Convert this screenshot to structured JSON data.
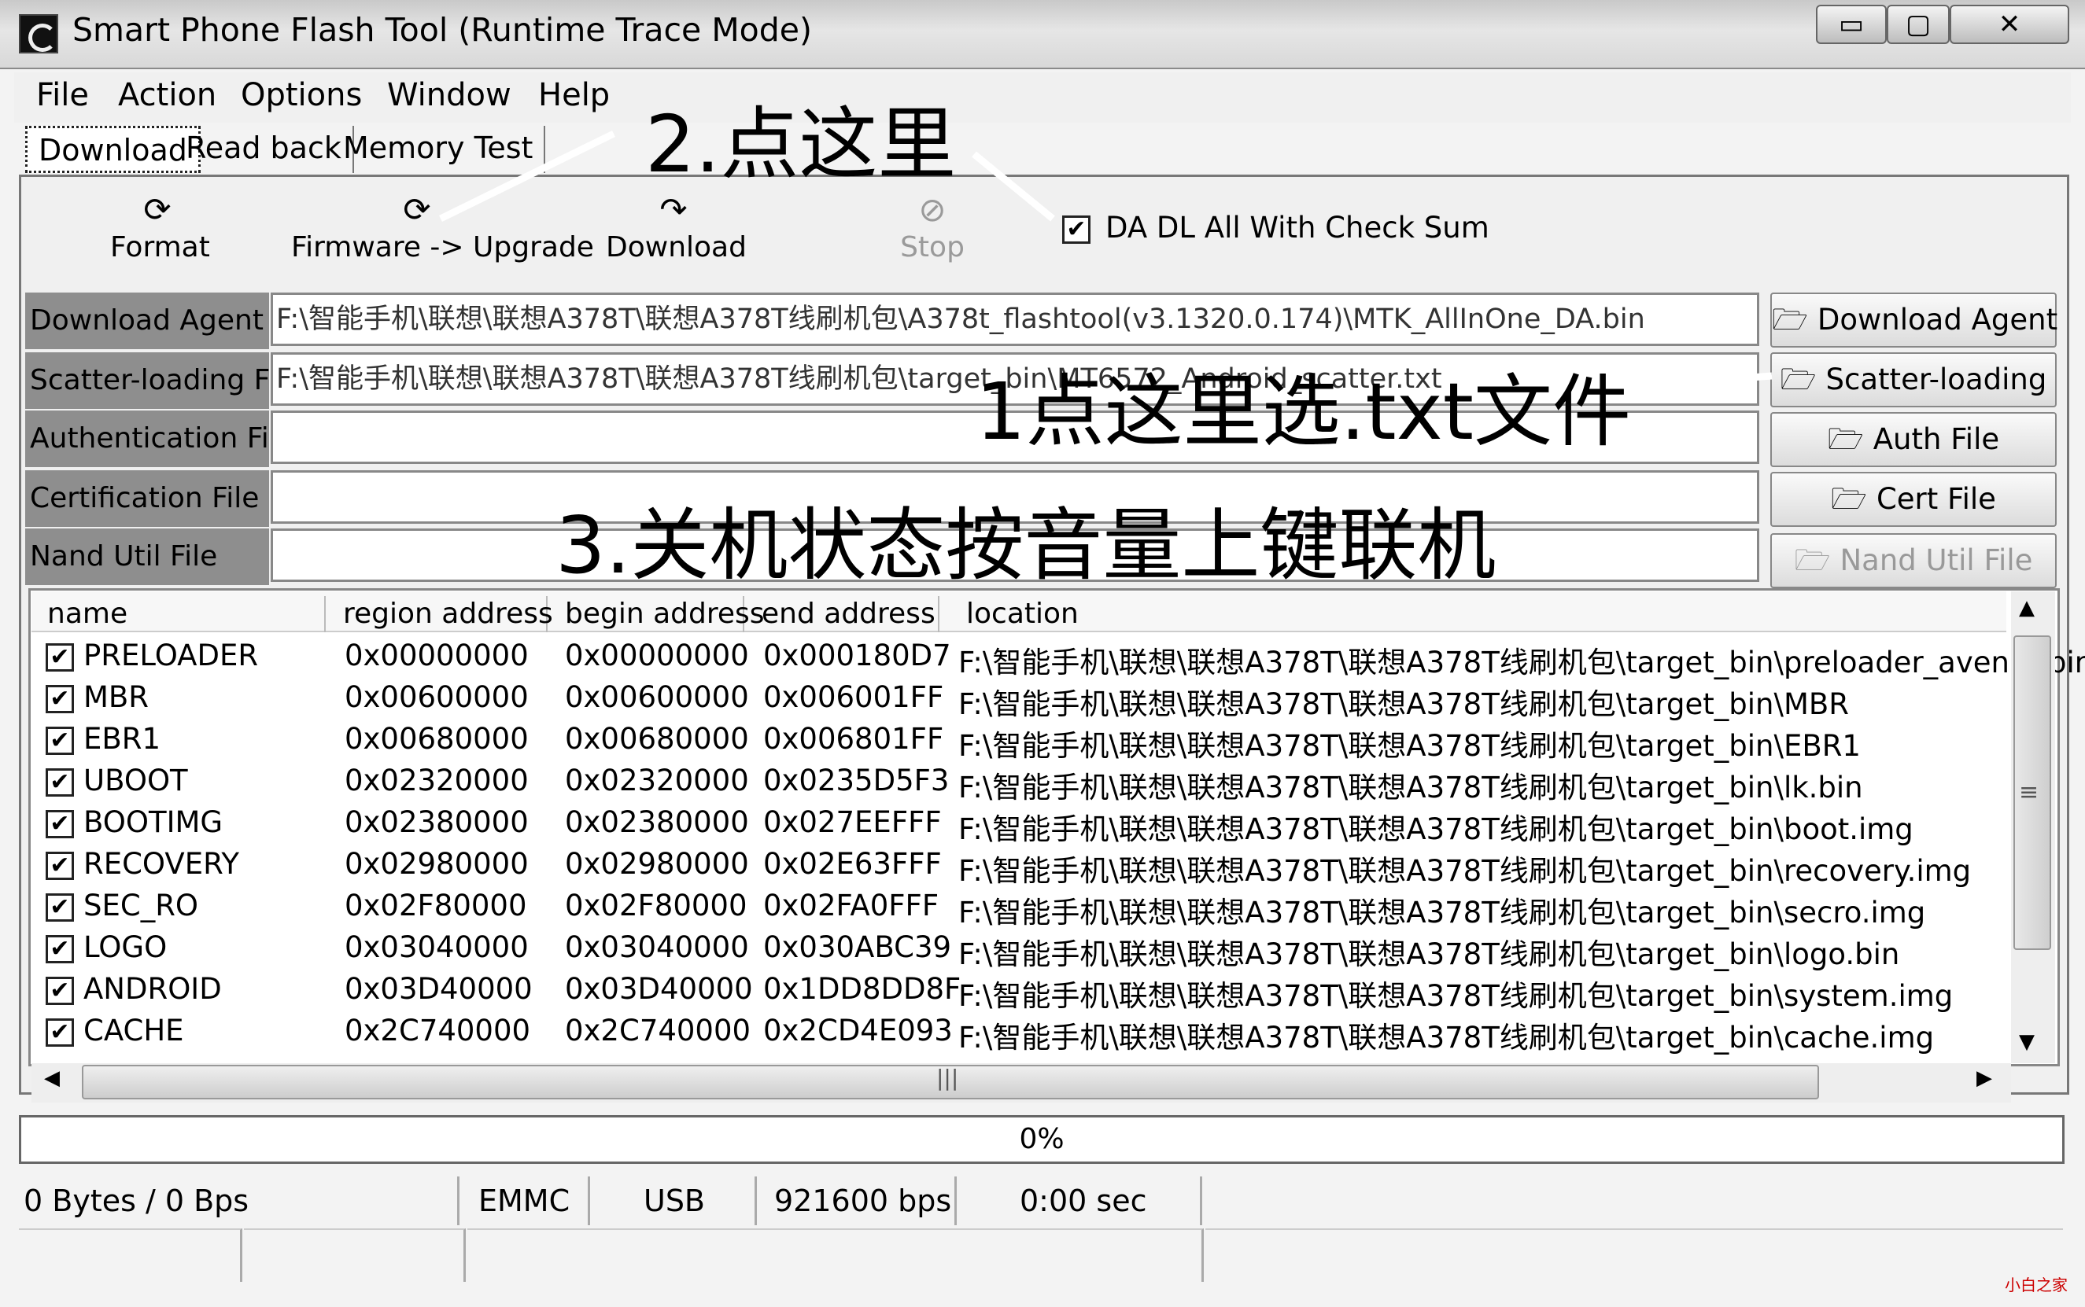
{
  "window": {
    "title": "Smart Phone Flash Tool (Runtime Trace Mode)",
    "controls": {
      "minimize": "▭",
      "maximize": "▢",
      "close": "✕"
    }
  },
  "menu": [
    "File",
    "Action",
    "Options",
    "Window",
    "Help"
  ],
  "tabs": [
    "Download",
    "Read back",
    "Memory Test"
  ],
  "toolbar": {
    "format": "Format",
    "firmware_upgrade": "Firmware -> Upgrade",
    "download": "Download",
    "stop": "Stop",
    "checksum_label": "DA DL All With Check Sum",
    "checksum_checked": true
  },
  "files": {
    "download_agent": {
      "label": "Download Agent",
      "path": "F:\\智能手机\\联想\\联想A378T\\联想A378T线刷机包\\A378t_flashtool(v3.1320.0.174)\\MTK_AllInOne_DA.bin",
      "button": "Download Agent"
    },
    "scatter": {
      "label": "Scatter-loading File",
      "path": "F:\\智能手机\\联想\\联想A378T\\联想A378T线刷机包\\target_bin\\MT6572_Android_scatter.txt",
      "button": "Scatter-loading"
    },
    "auth": {
      "label": "Authentication File",
      "path": "",
      "button": "Auth File"
    },
    "cert": {
      "label": "Certification File",
      "path": "",
      "button": "Cert File"
    },
    "nand": {
      "label": "Nand Util File",
      "path": "",
      "button": "Nand Util File"
    }
  },
  "table": {
    "columns": [
      "name",
      "region address",
      "begin address",
      "end address",
      "location"
    ],
    "rows": [
      {
        "name": "PRELOADER",
        "region": "0x00000000",
        "begin": "0x00000000",
        "end": "0x000180D7",
        "location": "F:\\智能手机\\联想\\联想A378T\\联想A378T线刷机包\\target_bin\\preloader_avenet.bin"
      },
      {
        "name": "MBR",
        "region": "0x00600000",
        "begin": "0x00600000",
        "end": "0x006001FF",
        "location": "F:\\智能手机\\联想\\联想A378T\\联想A378T线刷机包\\target_bin\\MBR"
      },
      {
        "name": "EBR1",
        "region": "0x00680000",
        "begin": "0x00680000",
        "end": "0x006801FF",
        "location": "F:\\智能手机\\联想\\联想A378T\\联想A378T线刷机包\\target_bin\\EBR1"
      },
      {
        "name": "UBOOT",
        "region": "0x02320000",
        "begin": "0x02320000",
        "end": "0x0235D5F3",
        "location": "F:\\智能手机\\联想\\联想A378T\\联想A378T线刷机包\\target_bin\\lk.bin"
      },
      {
        "name": "BOOTIMG",
        "region": "0x02380000",
        "begin": "0x02380000",
        "end": "0x027EEFFF",
        "location": "F:\\智能手机\\联想\\联想A378T\\联想A378T线刷机包\\target_bin\\boot.img"
      },
      {
        "name": "RECOVERY",
        "region": "0x02980000",
        "begin": "0x02980000",
        "end": "0x02E63FFF",
        "location": "F:\\智能手机\\联想\\联想A378T\\联想A378T线刷机包\\target_bin\\recovery.img"
      },
      {
        "name": "SEC_RO",
        "region": "0x02F80000",
        "begin": "0x02F80000",
        "end": "0x02FA0FFF",
        "location": "F:\\智能手机\\联想\\联想A378T\\联想A378T线刷机包\\target_bin\\secro.img"
      },
      {
        "name": "LOGO",
        "region": "0x03040000",
        "begin": "0x03040000",
        "end": "0x030ABC39",
        "location": "F:\\智能手机\\联想\\联想A378T\\联想A378T线刷机包\\target_bin\\logo.bin"
      },
      {
        "name": "ANDROID",
        "region": "0x03D40000",
        "begin": "0x03D40000",
        "end": "0x1DD8DD8F",
        "location": "F:\\智能手机\\联想\\联想A378T\\联想A378T线刷机包\\target_bin\\system.img"
      },
      {
        "name": "CACHE",
        "region": "0x2C740000",
        "begin": "0x2C740000",
        "end": "0x2CD4E093",
        "location": "F:\\智能手机\\联想\\联想A378T\\联想A378T线刷机包\\target_bin\\cache.img"
      }
    ]
  },
  "progress": {
    "text": "0%",
    "value": 0
  },
  "status": {
    "transfer": "0 Bytes / 0 Bps",
    "storage": "EMMC",
    "port": "USB",
    "baud": "921600 bps",
    "time": "0:00 sec"
  },
  "annotations": {
    "step1": "1点这里选.txt文件",
    "step2": "2.点这里",
    "step3": "3.关机状态按音量上键联机"
  },
  "watermark": "小白之家",
  "icons": [
    "app-icon",
    "format-icon",
    "firmware-icon",
    "download-icon",
    "stop-icon",
    "folder-open-icon",
    "checkbox-icon",
    "scroll-arrow-icon"
  ]
}
